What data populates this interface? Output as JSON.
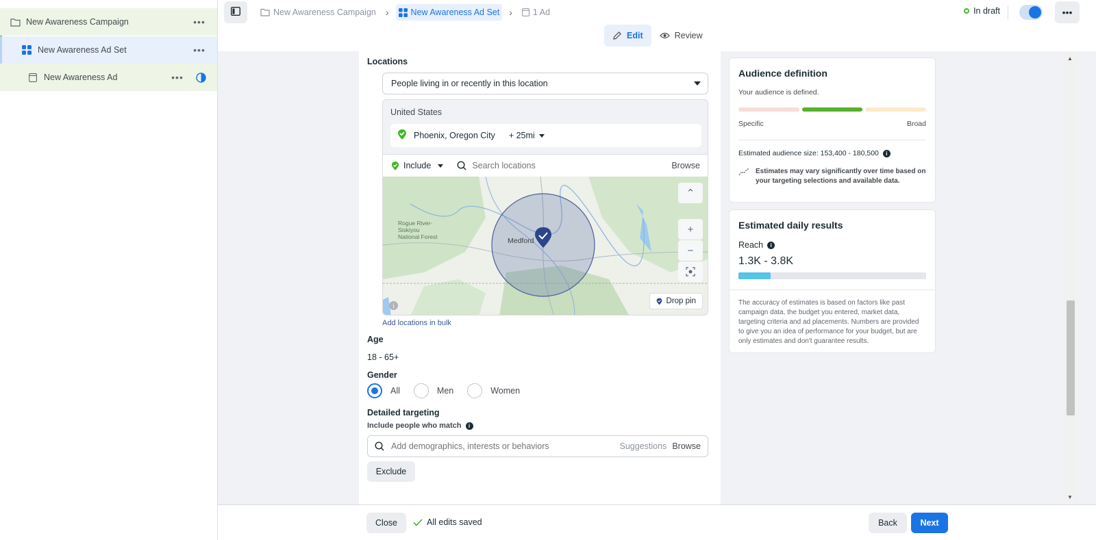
{
  "tree": {
    "campaign": "New Awareness Campaign",
    "adset": "New Awareness Ad Set",
    "ad": "New Awareness Ad",
    "more_glyph": "•••"
  },
  "topbar": {
    "breadcrumbs": [
      "New Awareness Campaign",
      "New Awareness Ad Set",
      "1 Ad"
    ],
    "status": "In draft",
    "more_glyph": "•••",
    "modes": {
      "edit": "Edit",
      "review": "Review"
    }
  },
  "locations": {
    "label": "Locations",
    "type": "People living in or recently in this location",
    "country": "United States",
    "selected": "Phoenix, Oregon City",
    "radius": "+ 25mi",
    "include": "Include",
    "search_placeholder": "Search locations",
    "browse": "Browse",
    "map": {
      "forest_label": "Rogue River-\nSiskiyou\nNational Forest",
      "city_label": "Medford",
      "drop_pin": "Drop pin",
      "zoom_in": "+",
      "zoom_out": "−",
      "collapse": "⌃"
    },
    "bulk": "Add locations in bulk"
  },
  "age": {
    "label": "Age",
    "value": "18 - 65+"
  },
  "gender": {
    "label": "Gender",
    "options": [
      "All",
      "Men",
      "Women"
    ],
    "selected": "All"
  },
  "detailed": {
    "label": "Detailed targeting",
    "sub": "Include people who match",
    "placeholder": "Add demographics, interests or behaviors",
    "suggestions": "Suggestions",
    "browse": "Browse",
    "exclude": "Exclude"
  },
  "audience": {
    "title": "Audience definition",
    "defined": "Your audience is defined.",
    "specific": "Specific",
    "broad": "Broad",
    "size": "Estimated audience size: 153,400 - 180,500",
    "vary": "Estimates may vary significantly over time based on your targeting selections and available data.",
    "colors": {
      "specific": "#f9dcd8",
      "middle": "#56b12a",
      "broad": "#fdebc8"
    }
  },
  "daily": {
    "title": "Estimated daily results",
    "reach_label": "Reach",
    "reach_value": "1.3K - 3.8K",
    "reach_fill_percent": 17,
    "disclaimer": "The accuracy of estimates is based on factors like past campaign data, the budget you entered, market data, targeting criteria and ad placements. Numbers are provided to give you an idea of performance for your budget, but are only estimates and don't guarantee results."
  },
  "footer": {
    "close": "Close",
    "saved": "All edits saved",
    "back": "Back",
    "next": "Next"
  },
  "colors": {
    "accent": "#1b74e4",
    "green": "#42b72a"
  }
}
